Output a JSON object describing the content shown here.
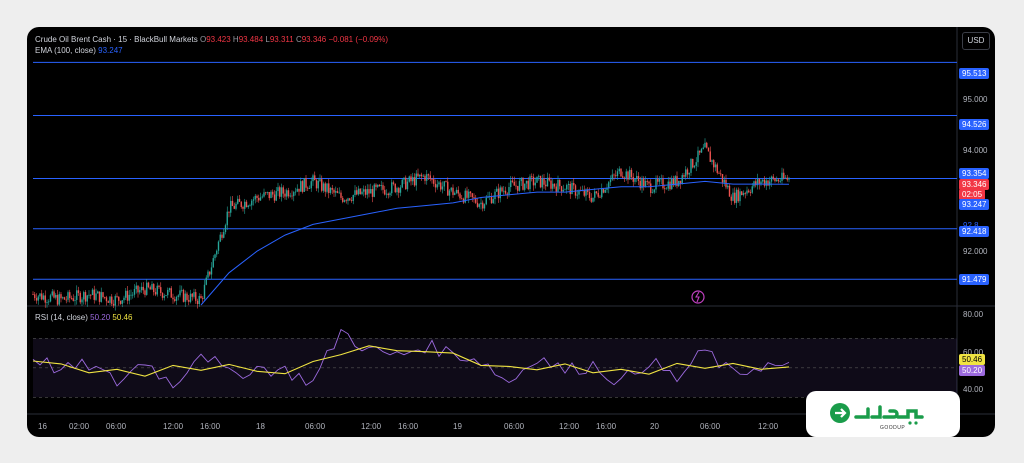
{
  "header": {
    "symbol": "Crude Oil Brent Cash · 15 · BlackBull Markets",
    "o_label": "O",
    "o_value": "93.423",
    "h_label": "H",
    "h_value": "93.484",
    "l_label": "L",
    "l_value": "93.311",
    "c_label": "C",
    "c_value": "93.346",
    "change": "−0.081 (−0.09%)",
    "ema_label": "EMA (100, close)",
    "ema_value": "93.247"
  },
  "currency": "USD",
  "rsi_header": {
    "label": "RSI (14, close)",
    "rsi_value": "50.20",
    "ma_value": "50.46"
  },
  "price_axis": {
    "ticks": [
      "95.000",
      "94.000",
      "92.000"
    ],
    "levels": [
      "95.513",
      "94.526",
      "93.354",
      "92.418",
      "91.479"
    ],
    "last_price": "93.346",
    "countdown": "02:05",
    "ema_tag": "93.247",
    "partial": "92.8"
  },
  "rsi_axis": {
    "ticks": [
      "80.00",
      "60.00",
      "40.00"
    ],
    "ma_tag": "50.46",
    "rsi_tag": "50.20"
  },
  "time_axis": [
    "16",
    "02:00",
    "06:00",
    "12:00",
    "16:00",
    "18",
    "06:00",
    "12:00",
    "16:00",
    "19",
    "06:00",
    "12:00",
    "16:00",
    "20",
    "06:00",
    "12:00"
  ],
  "logo": {
    "text": "GOODUP"
  },
  "colors": {
    "up": "#26a69a",
    "down": "#ef5350",
    "ema": "#2962ff",
    "level": "#2962ff",
    "rsi": "#9c6ade",
    "rsi_ma": "#f0e442"
  },
  "chart_data": {
    "type": "candlestick",
    "title": "Crude Oil Brent Cash · 15 · BlackBull Markets",
    "series": [
      {
        "name": "Price (close)",
        "x_hours": [
          0,
          4,
          8,
          12,
          16,
          20,
          24,
          28,
          32,
          36,
          40,
          44,
          48,
          52,
          56,
          60,
          64,
          68,
          72,
          76,
          80,
          84,
          88,
          92,
          96,
          100,
          104,
          108
        ],
        "values": [
          91.2,
          91.1,
          91.2,
          91.1,
          91.3,
          91.2,
          91.1,
          92.8,
          93.0,
          93.1,
          93.3,
          93.0,
          93.1,
          93.2,
          93.4,
          93.1,
          92.9,
          93.2,
          93.3,
          93.2,
          93.0,
          93.5,
          93.2,
          93.3,
          93.9,
          93.0,
          93.3,
          93.35
        ]
      },
      {
        "name": "EMA (100, close)",
        "values": [
          null,
          null,
          null,
          null,
          null,
          null,
          91.0,
          91.6,
          92.0,
          92.3,
          92.5,
          92.6,
          92.7,
          92.8,
          92.85,
          92.9,
          93.0,
          93.05,
          93.1,
          93.1,
          93.15,
          93.2,
          93.2,
          93.25,
          93.3,
          93.25,
          93.25,
          93.247
        ]
      }
    ],
    "levels": [
      95.513,
      94.526,
      93.354,
      92.418,
      91.479
    ],
    "ylim": [
      91.0,
      95.8
    ],
    "rsi": {
      "period": 14,
      "last": 50.2,
      "ma_last": 50.46,
      "ylim": [
        20,
        90
      ],
      "bands": [
        70,
        30
      ],
      "values": [
        58,
        48,
        52,
        40,
        55,
        38,
        62,
        45,
        50,
        48,
        40,
        75,
        62,
        58,
        65,
        60,
        55,
        40,
        58,
        48,
        52,
        40,
        55,
        42,
        62,
        45,
        52,
        50
      ]
    }
  }
}
